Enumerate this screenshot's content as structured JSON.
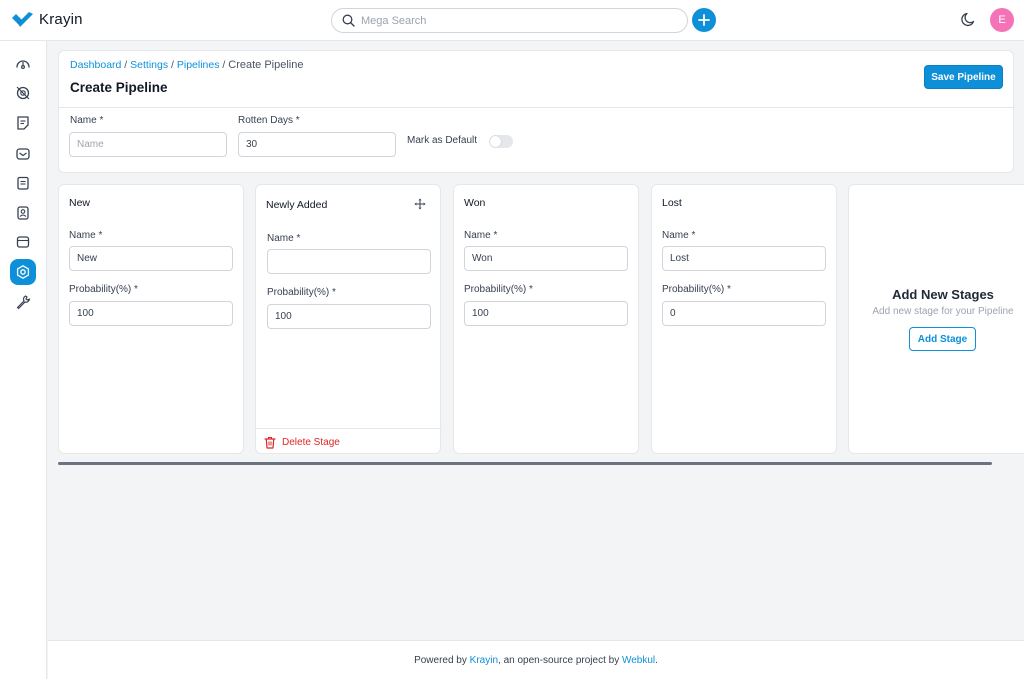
{
  "app": {
    "name": "Krayin",
    "brand_color": "#0e90d9"
  },
  "topbar": {
    "search_placeholder": "Mega Search",
    "avatar_initial": "E",
    "icons": [
      "search-icon",
      "plus-icon",
      "moon-icon"
    ]
  },
  "sidebar": {
    "items": [
      {
        "name": "dashboard",
        "icon": "speedometer-icon",
        "active": false
      },
      {
        "name": "leads",
        "icon": "leads-icon",
        "active": false
      },
      {
        "name": "quotes",
        "icon": "quote-icon",
        "active": false
      },
      {
        "name": "mail",
        "icon": "mail-icon",
        "active": false
      },
      {
        "name": "activities",
        "icon": "clipboard-icon",
        "active": false
      },
      {
        "name": "contacts",
        "icon": "contact-icon",
        "active": false
      },
      {
        "name": "products",
        "icon": "box-icon",
        "active": false
      },
      {
        "name": "settings",
        "icon": "settings-icon",
        "active": true
      },
      {
        "name": "configuration",
        "icon": "wrench-icon",
        "active": false
      }
    ]
  },
  "breadcrumb": {
    "dashboard": "Dashboard",
    "settings": "Settings",
    "pipelines": "Pipelines",
    "current": "Create Pipeline",
    "separator": " / "
  },
  "page": {
    "title": "Create Pipeline",
    "save_label": "Save Pipeline"
  },
  "form": {
    "name_label": "Name *",
    "name_placeholder": "Name",
    "name_value": "",
    "rotten_label": "Rotten Days *",
    "rotten_value": "30",
    "default_label": "Mark as Default",
    "default_on": false
  },
  "stages": [
    {
      "title": "New",
      "name_label": "Name *",
      "name_value": "New",
      "prob_label": "Probability(%) *",
      "prob_value": "100"
    },
    {
      "title": "Newly Added",
      "name_label": "Name *",
      "name_value": "",
      "prob_label": "Probability(%) *",
      "prob_value": "100",
      "delete_label": "Delete Stage"
    },
    {
      "title": "Won",
      "name_label": "Name *",
      "name_value": "Won",
      "prob_label": "Probability(%) *",
      "prob_value": "100"
    },
    {
      "title": "Lost",
      "name_label": "Name *",
      "name_value": "Lost",
      "prob_label": "Probability(%) *",
      "prob_value": "0"
    }
  ],
  "add_stage": {
    "title": "Add New Stages",
    "subtitle": "Add new stage for your Pipeline",
    "button_label": "Add Stage"
  },
  "footer": {
    "prefix": "Powered by ",
    "krayin_link": "Krayin",
    "middle": ", an open-source project by ",
    "webkul_link": "Webkul",
    "suffix": "."
  }
}
